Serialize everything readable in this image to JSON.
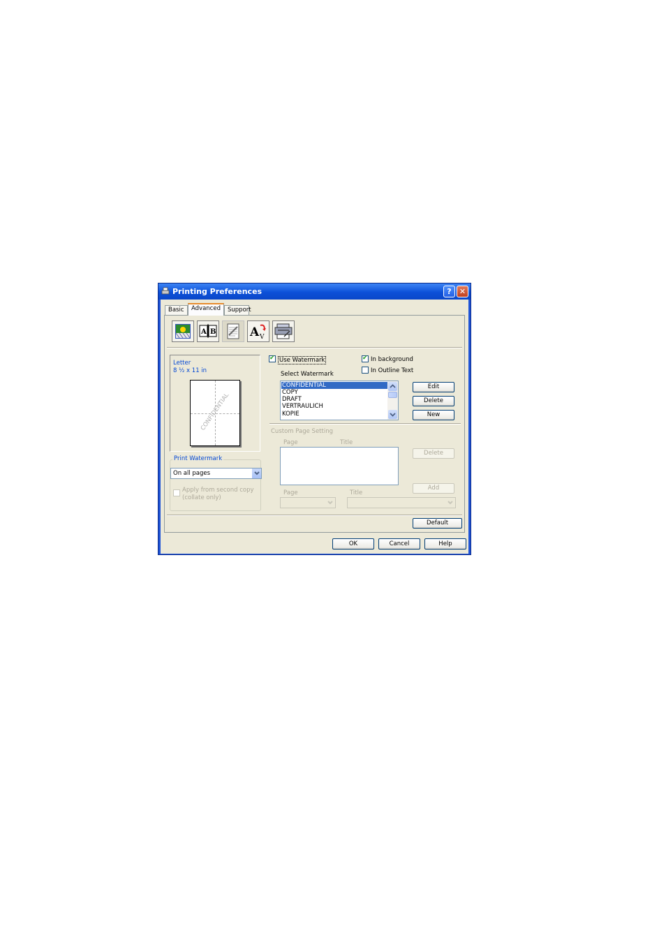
{
  "window": {
    "title": "Printing Preferences",
    "help_glyph": "?",
    "close_glyph": "✕"
  },
  "tabs": [
    {
      "label": "Basic"
    },
    {
      "label": "Advanced"
    },
    {
      "label": "Support"
    }
  ],
  "toolbar_icons": [
    "print-quality-icon",
    "duplex-icon",
    "watermark-icon",
    "page-setting-icon",
    "device-options-icon"
  ],
  "preview": {
    "paper_name": "Letter",
    "paper_size": "8 ½ x 11 in",
    "watermark_text": "CONFIDENTIAL"
  },
  "print_watermark": {
    "group_label": "Print Watermark",
    "selected": "On all pages",
    "apply_label_line1": "Apply from second copy",
    "apply_label_line2": "(collate only)"
  },
  "watermark": {
    "use_label": "Use Watermark",
    "use_checked": true,
    "background_label": "In background",
    "background_checked": true,
    "outline_label": "In Outline Text",
    "outline_checked": false,
    "select_label": "Select Watermark",
    "items": [
      "CONFIDENTIAL",
      "COPY",
      "DRAFT",
      "VERTRAULICH",
      "KOPIE"
    ],
    "selected_index": 0,
    "edit_label": "Edit",
    "delete_label": "Delete",
    "new_label": "New"
  },
  "custom_page": {
    "group_label": "Custom Page Setting",
    "col_page": "Page",
    "col_title": "Title",
    "delete_label": "Delete",
    "add_label": "Add",
    "page_label": "Page",
    "title_label": "Title"
  },
  "footer": {
    "default_label": "Default",
    "ok_label": "OK",
    "cancel_label": "Cancel",
    "help_label": "Help"
  }
}
